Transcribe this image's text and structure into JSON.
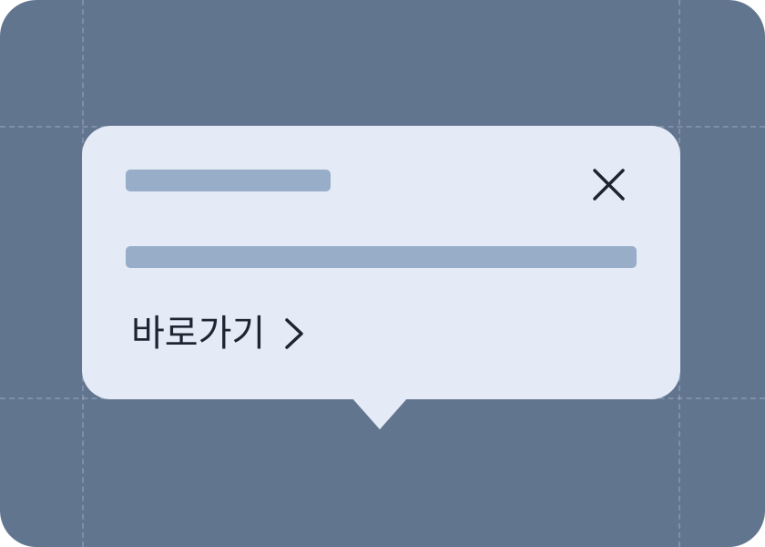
{
  "tooltip": {
    "link_label": "바로가기",
    "close_icon": "close-icon",
    "link_icon": "chevron-right-icon"
  },
  "colors": {
    "background": "#62758f",
    "tooltip_surface": "#e4ebf7",
    "placeholder": "#98adc7",
    "text": "#1f2433"
  }
}
